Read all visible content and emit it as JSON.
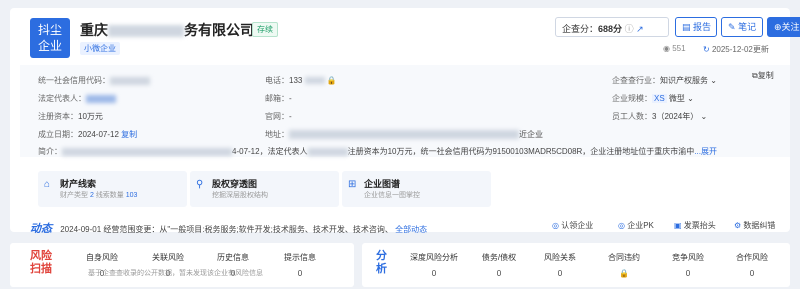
{
  "header": {
    "logo_line1": "抖尘",
    "logo_line2": "企业",
    "company_prefix": "重庆",
    "company_suffix": "务有限公司",
    "status_tag": "存续",
    "size_tag": "小微企业",
    "score_label": "企查分：",
    "score_value": "688分",
    "report_btn": "报告",
    "note_btn": "笔记",
    "follow_btn": "关注",
    "views": "551",
    "updated": "2025-12-02更新"
  },
  "info": {
    "credit_code_label": "统一社会信用代码：",
    "legal_rep_label": "法定代表人：",
    "reg_capital_label": "注册资本：",
    "reg_capital_value": "10万元",
    "est_date_label": "成立日期：",
    "est_date_value": "2024-07-12",
    "copy_label": "复制",
    "phone_label": "电话：",
    "phone_value": "133",
    "email_label": "邮箱：",
    "email_value": "-",
    "website_label": "官网：",
    "website_value": "-",
    "address_label": "地址：",
    "address_tail": "近企业",
    "industry_label": "企查查行业：",
    "industry_value": "知识产权服务",
    "scale_label": "企业规模：",
    "scale_badge": "XS",
    "scale_value": "微型",
    "staff_label": "员工人数：",
    "staff_value": "3（2024年）",
    "copy_right": "复制",
    "intro_label": "简介：",
    "intro_text": "4-07-12，法定代表人",
    "intro_text2": "注册资本为10万元，统一社会信用代码为91500103MADR5CD08R，企业注册地址位于重庆市渝中",
    "intro_more": "...展开"
  },
  "tiles": [
    {
      "title": "财产线索",
      "sub_pre": "财产类型",
      "sub_num1": "2",
      "sub_mid": "线索数量",
      "sub_num2": "103"
    },
    {
      "title": "股权穿透图",
      "sub": "挖掘深层股权结构"
    },
    {
      "title": "企业图谱",
      "sub": "企业信息一图掌控"
    }
  ],
  "dynamic": {
    "title": "动态",
    "text": "2024-09-01 经营范围变更：从\"一般项目:税务服务;软件开发;技术服务、技术开发、技术咨询、",
    "more": "全部动态",
    "btn1": "认领企业",
    "btn2": "企业PK",
    "btn3": "发票抬头",
    "btn4": "数据纠错"
  },
  "risk": {
    "label1": "风险",
    "label2": "扫描",
    "items": [
      {
        "name": "自身风险",
        "value": "0"
      },
      {
        "name": "关联风险",
        "value": "0"
      },
      {
        "name": "历史信息",
        "value": "0"
      },
      {
        "name": "提示信息",
        "value": "0"
      }
    ],
    "hint": "基于企查查收录的公开数据，暂未发现该企业有风险信息"
  },
  "analysis": {
    "label1": "分",
    "label2": "析",
    "items": [
      {
        "name": "深度风险分析",
        "value": "0"
      },
      {
        "name": "债务/债权",
        "value": "0"
      },
      {
        "name": "风险关系",
        "value": "0"
      },
      {
        "name": "合同违约",
        "value": ""
      },
      {
        "name": "竞争风险",
        "value": "0"
      },
      {
        "name": "合作风险",
        "value": "0"
      }
    ]
  },
  "colors": {
    "accent": "#2c6de0",
    "green": "#22a06b",
    "risk": "#e0433b"
  }
}
